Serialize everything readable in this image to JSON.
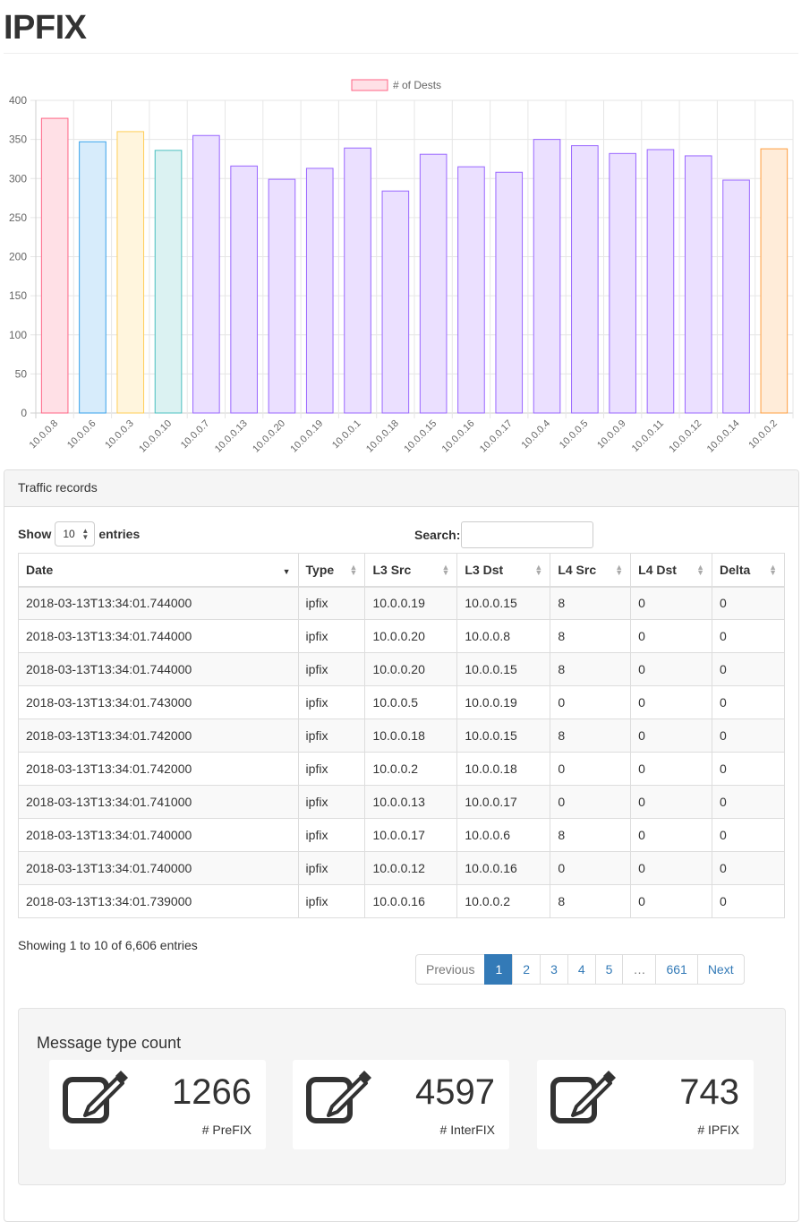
{
  "page": {
    "title": "IPFIX"
  },
  "chart_data": {
    "type": "bar",
    "legend": [
      "# of Dests"
    ],
    "legend_position": "top",
    "categories": [
      "10.0.0.8",
      "10.0.0.6",
      "10.0.0.3",
      "10.0.0.10",
      "10.0.0.7",
      "10.0.0.13",
      "10.0.0.20",
      "10.0.0.19",
      "10.0.0.1",
      "10.0.0.18",
      "10.0.0.15",
      "10.0.0.16",
      "10.0.0.17",
      "10.0.0.4",
      "10.0.0.5",
      "10.0.0.9",
      "10.0.0.11",
      "10.0.0.12",
      "10.0.0.14",
      "10.0.0.2"
    ],
    "series": [
      {
        "name": "# of Dests",
        "values": [
          377,
          347,
          360,
          336,
          355,
          316,
          299,
          313,
          339,
          284,
          331,
          315,
          308,
          350,
          342,
          332,
          337,
          329,
          298,
          338
        ]
      }
    ],
    "ylim": [
      0,
      400
    ],
    "yticks": [
      0,
      50,
      100,
      150,
      200,
      250,
      300,
      350,
      400
    ],
    "grid": true,
    "colors": {
      "fill": [
        "#ffe0e6",
        "#d7ecfb",
        "#fff5dd",
        "#dbf2f2",
        "#ebe0ff",
        "#ebe0ff",
        "#ebe0ff",
        "#ebe0ff",
        "#ebe0ff",
        "#ebe0ff",
        "#ebe0ff",
        "#ebe0ff",
        "#ebe0ff",
        "#ebe0ff",
        "#ebe0ff",
        "#ebe0ff",
        "#ebe0ff",
        "#ebe0ff",
        "#ebe0ff",
        "#ffecd9"
      ],
      "stroke": [
        "#ff6384",
        "#36a2eb",
        "#ffce56",
        "#4bc0c0",
        "#9966ff",
        "#9966ff",
        "#9966ff",
        "#9966ff",
        "#9966ff",
        "#9966ff",
        "#9966ff",
        "#9966ff",
        "#9966ff",
        "#9966ff",
        "#9966ff",
        "#9966ff",
        "#9966ff",
        "#9966ff",
        "#9966ff",
        "#ff9f40"
      ]
    }
  },
  "panel": {
    "heading": "Traffic records",
    "show_label": "Show",
    "entries_label": "entries",
    "length_value": "10",
    "search_label": "Search:",
    "search_value": "",
    "columns": [
      "Date",
      "Type",
      "L3 Src",
      "L3 Dst",
      "L4 Src",
      "L4 Dst",
      "Delta"
    ],
    "rows": [
      [
        "2018-03-13T13:34:01.744000",
        "ipfix",
        "10.0.0.19",
        "10.0.0.15",
        "8",
        "0",
        "0"
      ],
      [
        "2018-03-13T13:34:01.744000",
        "ipfix",
        "10.0.0.20",
        "10.0.0.8",
        "8",
        "0",
        "0"
      ],
      [
        "2018-03-13T13:34:01.744000",
        "ipfix",
        "10.0.0.20",
        "10.0.0.15",
        "8",
        "0",
        "0"
      ],
      [
        "2018-03-13T13:34:01.743000",
        "ipfix",
        "10.0.0.5",
        "10.0.0.19",
        "0",
        "0",
        "0"
      ],
      [
        "2018-03-13T13:34:01.742000",
        "ipfix",
        "10.0.0.18",
        "10.0.0.15",
        "8",
        "0",
        "0"
      ],
      [
        "2018-03-13T13:34:01.742000",
        "ipfix",
        "10.0.0.2",
        "10.0.0.18",
        "0",
        "0",
        "0"
      ],
      [
        "2018-03-13T13:34:01.741000",
        "ipfix",
        "10.0.0.13",
        "10.0.0.17",
        "0",
        "0",
        "0"
      ],
      [
        "2018-03-13T13:34:01.740000",
        "ipfix",
        "10.0.0.17",
        "10.0.0.6",
        "8",
        "0",
        "0"
      ],
      [
        "2018-03-13T13:34:01.740000",
        "ipfix",
        "10.0.0.12",
        "10.0.0.16",
        "0",
        "0",
        "0"
      ],
      [
        "2018-03-13T13:34:01.739000",
        "ipfix",
        "10.0.0.16",
        "10.0.0.2",
        "8",
        "0",
        "0"
      ]
    ],
    "info": "Showing 1 to 10 of 6,606 entries",
    "pagination": {
      "previous": "Previous",
      "pages": [
        "1",
        "2",
        "3",
        "4",
        "5",
        "…",
        "661"
      ],
      "active_page": "1",
      "next": "Next"
    }
  },
  "message_counts": {
    "title": "Message type count",
    "items": [
      {
        "value": "1266",
        "label": "# PreFIX",
        "icon": "edit-icon"
      },
      {
        "value": "4597",
        "label": "# InterFIX",
        "icon": "edit-icon"
      },
      {
        "value": "743",
        "label": "# IPFIX",
        "icon": "edit-icon"
      }
    ]
  }
}
